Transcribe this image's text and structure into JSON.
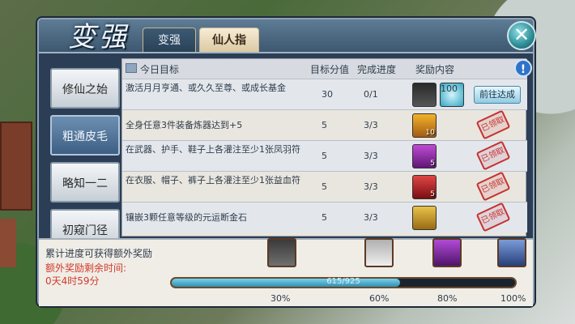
{
  "panel": {
    "title": "变强"
  },
  "tabs": [
    "变强",
    "仙人指路"
  ],
  "sidebar": [
    "修仙之始",
    "粗通皮毛",
    "略知一二",
    "初窥门径"
  ],
  "header": {
    "goal": "今日目标",
    "score": "目标分值",
    "progress": "完成进度",
    "reward": "奖励内容",
    "info": "!"
  },
  "rows": [
    {
      "desc": "激活月月亨通、或久久至尊、或成长基金",
      "score": "30",
      "progress": "0/1",
      "reward_count": "",
      "reward2_count": "100",
      "action": "前往达成"
    },
    {
      "desc": "全身任意3件装备炼器达到+5",
      "score": "5",
      "progress": "3/3",
      "reward_count": "10",
      "stamp": "已领取"
    },
    {
      "desc": "在武器、护手、鞋子上各灌注至少1张凤羽符",
      "score": "5",
      "progress": "3/3",
      "reward_count": "5",
      "stamp": "已领取"
    },
    {
      "desc": "在衣服、帽子、裤子上各灌注至少1张益血符",
      "score": "5",
      "progress": "3/3",
      "reward_count": "5",
      "stamp": "已领取"
    },
    {
      "desc": "镶嵌3颗任意等级的元运断金石",
      "score": "5",
      "progress": "3/3",
      "reward_count": "",
      "stamp": "已领取"
    }
  ],
  "bottom": {
    "cum_text": "累计进度可获得额外奖励",
    "extra_text": "额外奖励剩余时间:",
    "time_text": "0天4时59分",
    "progress_label": "615/925",
    "progress_value": 0.665,
    "milestones": [
      "30%",
      "60%",
      "80%",
      "100%"
    ]
  },
  "colors": {
    "accent": "#2e8fb5",
    "warning": "#d23a2a"
  }
}
